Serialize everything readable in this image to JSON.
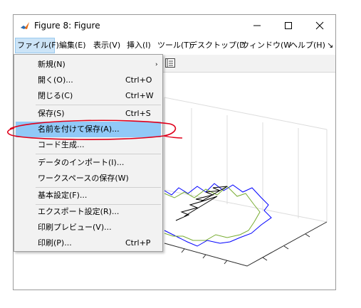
{
  "window": {
    "title": "Figure 8: Figure",
    "controls": {
      "minimize": "—",
      "maximize": "☐",
      "close": "✕"
    }
  },
  "menubar": {
    "items": [
      "ファイル(F)",
      "編集(E)",
      "表示(V)",
      "挿入(I)",
      "ツール(T)",
      "デスクトップ(D",
      "ウィンドウ(W",
      "ヘルプ(H)"
    ],
    "overflow": "↘"
  },
  "file_menu": {
    "items": [
      {
        "label": "新規(N)",
        "shortcut": "",
        "submenu": "›"
      },
      {
        "label": "開く(O)...",
        "shortcut": "Ctrl+O"
      },
      {
        "label": "閉じる(C)",
        "shortcut": "Ctrl+W"
      },
      {
        "label": "保存(S)",
        "shortcut": "Ctrl+S"
      },
      {
        "label": "名前を付けて保存(A)...",
        "shortcut": ""
      },
      {
        "label": "コード生成...",
        "shortcut": ""
      },
      {
        "label": "データのインポート(I)...",
        "shortcut": ""
      },
      {
        "label": "ワークスペースの保存(W)",
        "shortcut": ""
      },
      {
        "label": "基本設定(F)...",
        "shortcut": ""
      },
      {
        "label": "エクスポート設定(R)...",
        "shortcut": ""
      },
      {
        "label": "印刷プレビュー(V)...",
        "shortcut": ""
      },
      {
        "label": "印刷(P)...",
        "shortcut": "Ctrl+P"
      }
    ],
    "highlighted_index": 4
  },
  "colors": {
    "menu_highlight": "#91c9f7",
    "active_menu_bg": "#cce4f7",
    "annotation_red": "#e0001b",
    "series_blue": "#0000ff",
    "series_green": "#77ac30",
    "series_black": "#000000"
  }
}
